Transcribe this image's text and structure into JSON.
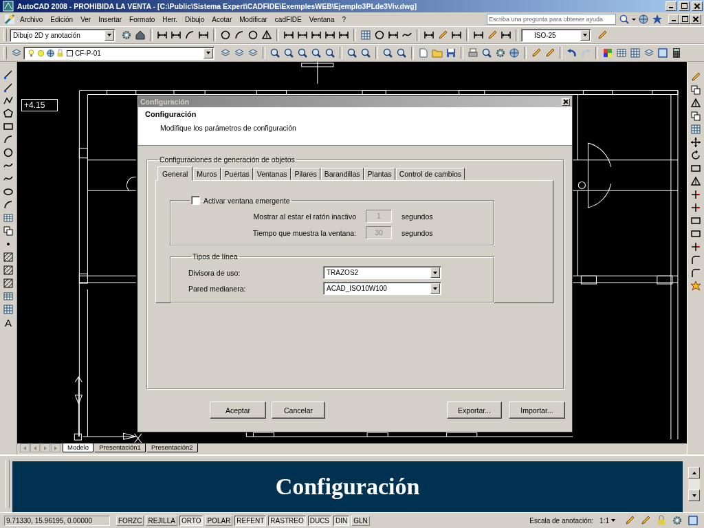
{
  "window": {
    "title": "AutoCAD 2008 - PROHIBIDA LA VENTA - [C:\\Public\\Sistema Expert\\CADFIDE\\ExemplesWEB\\Ejemplo3PLde3Viv.dwg]"
  },
  "menu": [
    "Archivo",
    "Edición",
    "Ver",
    "Insertar",
    "Formato",
    "Herr.",
    "Dibujo",
    "Acotar",
    "Modificar",
    "cadFIDE",
    "Ventana",
    "?"
  ],
  "help_search": {
    "placeholder": "Escriba una pregunta para obtener ayuda"
  },
  "workspace_select": {
    "value": "Dibujo 2D y anotación"
  },
  "dimstyle_select": {
    "value": "ISO-25"
  },
  "layer_select": {
    "value": "CF-P-01"
  },
  "left_toolbar": {
    "text_tool": "A"
  },
  "canvas": {
    "elevation_label": "+4.15"
  },
  "layout_tabs": [
    {
      "label": "Modelo",
      "selected": true
    },
    {
      "label": "Presentación1",
      "selected": false
    },
    {
      "label": "Presentación2",
      "selected": false
    }
  ],
  "dialog": {
    "title": "Configuración",
    "header_title": "Configuración",
    "header_subtitle": "Modifique los parámetros de configuración",
    "group_title": "Configuraciones de generación de objetos",
    "tabs": [
      {
        "label": "General",
        "selected": true
      },
      {
        "label": "Muros",
        "selected": false
      },
      {
        "label": "Puertas",
        "selected": false
      },
      {
        "label": "Ventanas",
        "selected": false
      },
      {
        "label": "Pilares",
        "selected": false
      },
      {
        "label": "Barandillas",
        "selected": false
      },
      {
        "label": "Plantas",
        "selected": false
      },
      {
        "label": "Control de cambios",
        "selected": false
      }
    ],
    "popup": {
      "label": "Activar ventana emergente",
      "checked": false,
      "rows": [
        {
          "label": "Mostrar al estar el ratón inactivo",
          "value": "1",
          "unit": "segundos",
          "disabled": true
        },
        {
          "label": "Tiempo que muestra la ventana:",
          "value": "30",
          "unit": "segundos",
          "disabled": true
        }
      ]
    },
    "linetypes": {
      "title": "Tipos de línea",
      "rows": [
        {
          "label": "Divisora de uso:",
          "value": "TRAZOS2"
        },
        {
          "label": "Pared medianera:",
          "value": "ACAD_ISO10W100"
        }
      ]
    },
    "buttons": [
      "Aceptar",
      "Cancelar",
      "Exportar...",
      "Importar..."
    ]
  },
  "command_banner": {
    "text": "Configuración"
  },
  "status_bar": {
    "coordinates": "9.71330, 15.96195, 0.00000",
    "toggles": [
      {
        "label": "FORZC",
        "on": false
      },
      {
        "label": "REJILLA",
        "on": false
      },
      {
        "label": "ORTO",
        "on": true
      },
      {
        "label": "POLAR",
        "on": false
      },
      {
        "label": "REFENT",
        "on": true
      },
      {
        "label": "RASTREO",
        "on": true
      },
      {
        "label": "DUCS",
        "on": true
      },
      {
        "label": "DIN",
        "on": true
      },
      {
        "label": "GLN",
        "on": false
      }
    ],
    "annotation_scale_label": "Escala de anotación:",
    "annotation_scale": "1:1"
  }
}
